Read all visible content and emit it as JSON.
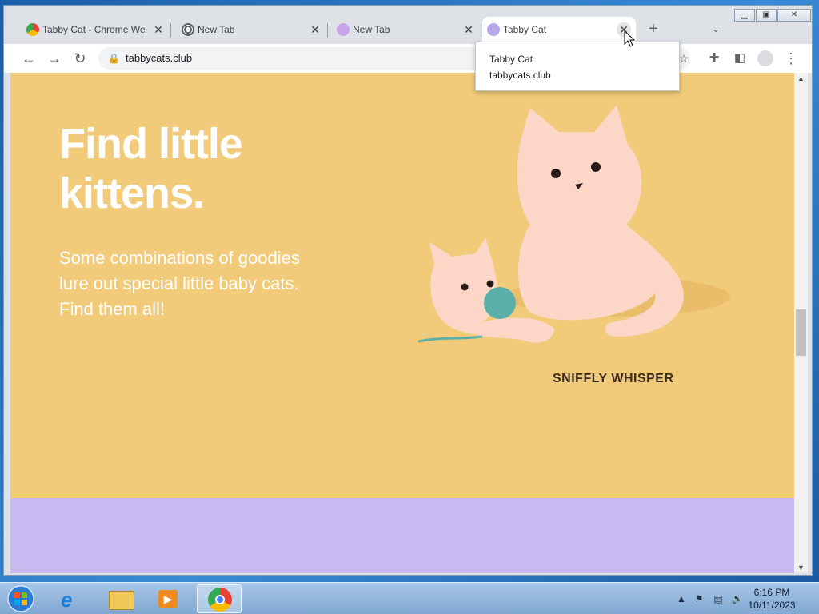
{
  "browser": {
    "tabs": [
      {
        "label": "Tabby Cat - Chrome Wel",
        "favicon": "chrome-web-store-icon",
        "active": false
      },
      {
        "label": "New Tab",
        "favicon": "chrome-icon",
        "active": false
      },
      {
        "label": "New Tab",
        "favicon": "tabby-cat-icon",
        "active": false
      },
      {
        "label": "Tabby Cat",
        "favicon": "tabby-cat-icon",
        "active": true
      }
    ],
    "new_tab_label": "+",
    "address": "tabbycats.club",
    "tooltip": {
      "title": "Tabby Cat",
      "url": "tabbycats.club"
    }
  },
  "page": {
    "title": "Find little kittens.",
    "subtitle": "Some combinations of goodies lure out special little baby cats. Find them all!",
    "cat_name": "SNIFFLY WHISPER",
    "colors": {
      "hero_bg": "#f2cb7a",
      "cat": "#fcd6c6",
      "next_section": "#c8b9f0",
      "yarn": "#5ab0a8"
    }
  },
  "taskbar": {
    "time": "6:16 PM",
    "date": "10/11/2023",
    "apps": [
      "internet-explorer-icon",
      "file-explorer-icon",
      "media-player-icon",
      "chrome-icon"
    ]
  }
}
